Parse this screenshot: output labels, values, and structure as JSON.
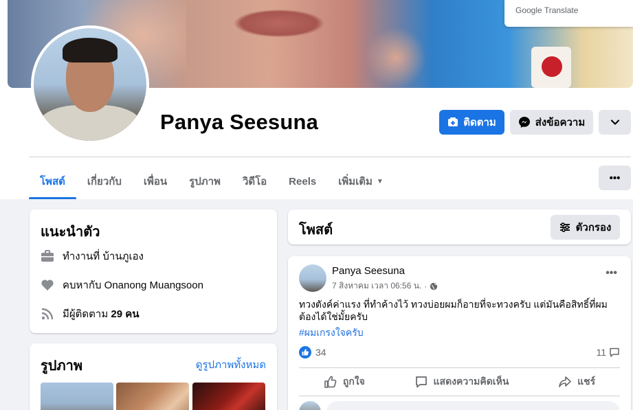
{
  "profile": {
    "name": "Panya Seesuna"
  },
  "overlay": {
    "google_translate_label": "Google Translate"
  },
  "header_buttons": {
    "follow_label": "ติดตาม",
    "message_label": "ส่งข้อความ"
  },
  "tabs": [
    {
      "label": "โพสต์",
      "active": true
    },
    {
      "label": "เกี่ยวกับ",
      "active": false
    },
    {
      "label": "เพื่อน",
      "active": false
    },
    {
      "label": "รูปภาพ",
      "active": false
    },
    {
      "label": "วิดีโอ",
      "active": false
    },
    {
      "label": "Reels",
      "active": false
    },
    {
      "label": "เพิ่มเติม",
      "active": false
    }
  ],
  "intro": {
    "title": "แนะนำตัว",
    "work_prefix": "ทำงานที่",
    "work_place": "บ้านภูเอง",
    "relationship_prefix": "คบหากับ",
    "relationship_partner": "Onanong Muangsoon",
    "followers_prefix": "มีผู้ติดตาม",
    "followers_count": "29 คน"
  },
  "photos": {
    "title": "รูปภาพ",
    "see_all_label": "ดูรูปภาพทั้งหมด"
  },
  "posts_header": {
    "title": "โพสต์",
    "filter_label": "ตัวกรอง"
  },
  "post": {
    "author": "Panya Seesuna",
    "timestamp": "7 สิงหาคม เวลา 06:56 น.",
    "text": "ทวงตังค์ค่าแรง ที่ทำค้างไว้ ทวงบ่อยผมก็อายที่จะทวงครับ แต่มันคือสิทธิ์ที่ผมต้องได้ใช่มั้ยครับ",
    "hashtag": "#ผมเกรงใจครับ",
    "reactions_count": "34",
    "comments_count": "11",
    "like_label": "ถูกใจ",
    "comment_label": "แสดงความคิดเห็น",
    "share_label": "แชร์"
  },
  "colors": {
    "accent": "#1b74e4",
    "hashtag": "#216fdb",
    "secondary_button": "#e4e6eb",
    "page_background": "#f0f2f5"
  }
}
